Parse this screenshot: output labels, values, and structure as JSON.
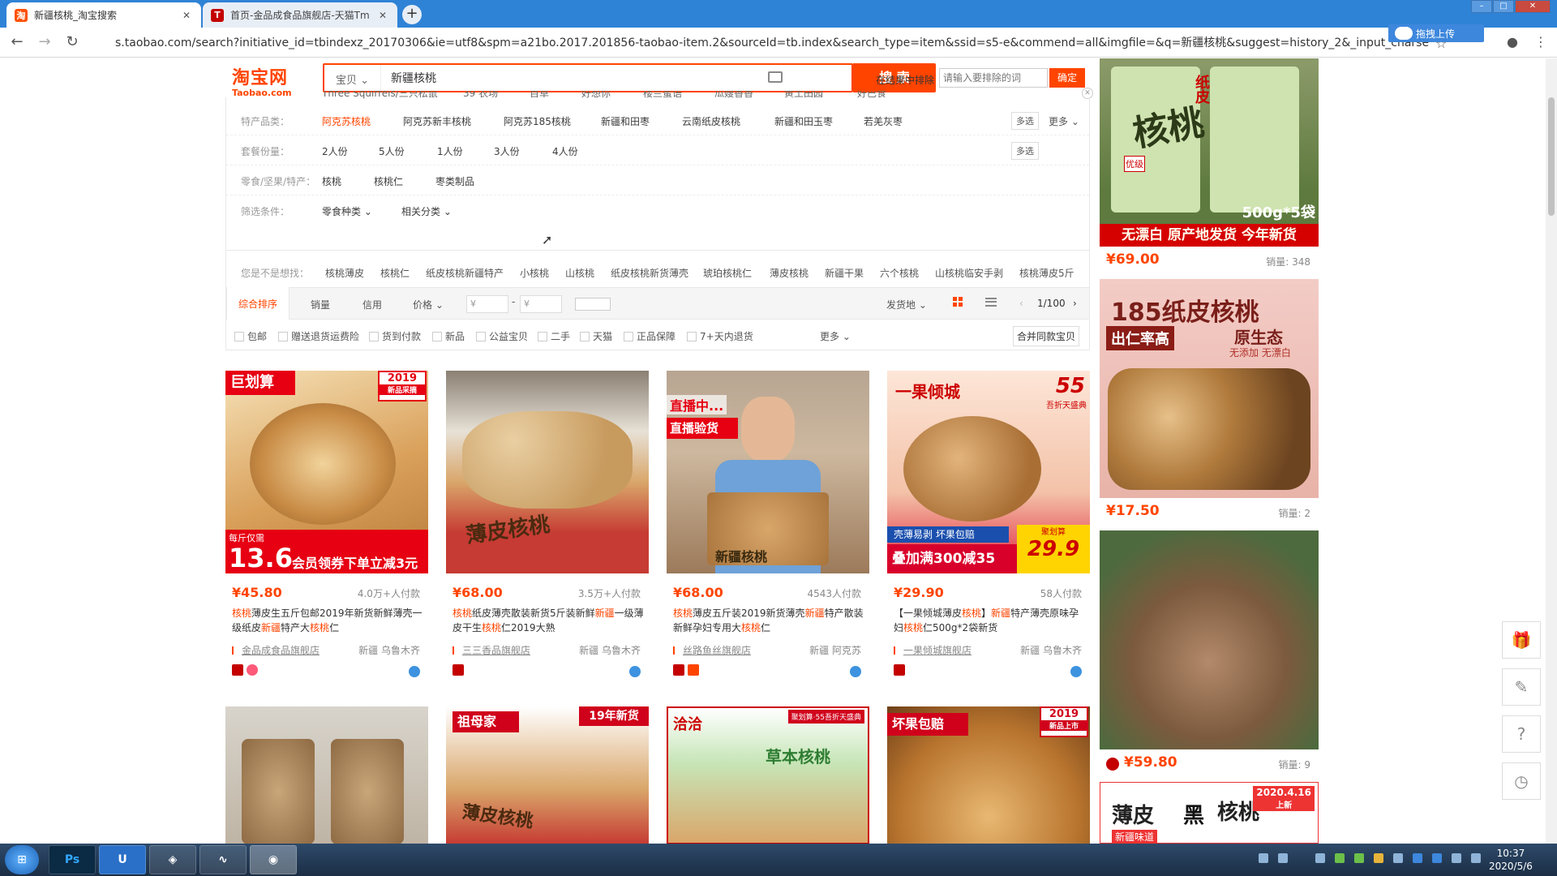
{
  "browser": {
    "tabs": [
      {
        "title": "新疆核桃_淘宝搜索",
        "icon": "淘"
      },
      {
        "title": "首页-金品成食品旗舰店-天猫Tm",
        "icon": "T"
      }
    ],
    "url": "s.taobao.com/search?initiative_id=tbindexz_20170306&ie=utf8&spm=a21bo.2017.201856-taobao-item.2&sourceId=tb.index&search_type=item&ssid=s5-e&commend=all&imgfile=&q=新疆核桃&suggest=history_2&_input_charset=utf-8",
    "upload_label": "拖拽上传",
    "new_tab_label": "+"
  },
  "header": {
    "logo_cn": "淘宝网",
    "logo_en": "Taobao.com",
    "search_category": "宝贝",
    "search_value": "新疆核桃",
    "search_button": "搜 索",
    "exclude_label": "在结果中排除",
    "exclude_placeholder": "请输入要排除的词",
    "exclude_button": "确定"
  },
  "filters": {
    "partial_row": [
      "Three Squirrels/三只松鼠",
      "39 农场",
      "百草",
      "好想你",
      "楼兰蜜语",
      "瓜嫂香香",
      "黄土田园",
      "好巴食"
    ],
    "rows": [
      {
        "label": "特产品类：",
        "items": [
          "阿克苏核桃",
          "阿克苏新丰核桃",
          "阿克苏185核桃",
          "新疆和田枣",
          "云南纸皮核桃",
          "新疆和田玉枣",
          "若羌灰枣"
        ],
        "multi": "多选",
        "more": "更多"
      },
      {
        "label": "套餐份量：",
        "items": [
          "2人份",
          "5人份",
          "1人份",
          "3人份",
          "4人份"
        ],
        "multi": "多选"
      },
      {
        "label": "零食/坚果/特产：",
        "items": [
          "核桃",
          "核桃仁",
          "枣类制品"
        ]
      },
      {
        "label": "筛选条件：",
        "items": [
          "零食种类",
          "相关分类"
        ]
      }
    ],
    "guess_label": "您是不是想找：",
    "guess_items": [
      "核桃薄皮",
      "核桃仁",
      "纸皮核桃新疆特产",
      "小核桃",
      "山核桃",
      "纸皮核桃新货薄壳",
      "琥珀核桃仁",
      "薄皮核桃",
      "新疆干果",
      "六个核桃",
      "山核桃临安手剥",
      "核桃薄皮5斤"
    ]
  },
  "sortbar": {
    "items": [
      "综合排序",
      "销量",
      "信用",
      "价格"
    ],
    "price_from": "¥",
    "price_to": "¥",
    "location": "发货地",
    "page": "1/100"
  },
  "checks": [
    "包邮",
    "赠送退货运费险",
    "货到付款",
    "新品",
    "公益宝贝",
    "二手",
    "天猫",
    "正品保障",
    "7+天内退货"
  ],
  "checks_more": "更多",
  "merge_button": "合并同款宝贝",
  "products": [
    {
      "price": "¥45.80",
      "sales": "4.0万+人付款",
      "title_pre": "",
      "title": [
        [
          "核桃",
          1
        ],
        [
          "薄皮生五斤包邮2019年新货新鲜薄壳一级纸皮",
          0
        ],
        [
          "新疆",
          1
        ],
        [
          "特产大",
          0
        ],
        [
          "核桃",
          1
        ],
        [
          "仁",
          0
        ]
      ],
      "shop": "金品成食品旗舰店",
      "loc": "新疆 乌鲁木齐",
      "img_text": [
        "巨划算",
        "2019",
        "新品采摘",
        "每斤仅需",
        "13.6",
        "会员领券下单立减3元"
      ]
    },
    {
      "price": "¥68.00",
      "sales": "3.5万+人付款",
      "title": [
        [
          "核桃",
          1
        ],
        [
          "纸皮薄壳散装新货5斤装新鲜",
          0
        ],
        [
          "新疆",
          1
        ],
        [
          "一级薄皮干生",
          0
        ],
        [
          "核桃",
          1
        ],
        [
          "仁2019大熟",
          0
        ]
      ],
      "shop": "三三香品旗舰店",
      "loc": "新疆 乌鲁木齐",
      "img_text": [
        "薄皮核桃"
      ]
    },
    {
      "price": "¥68.00",
      "sales": "4543人付款",
      "title": [
        [
          "核桃",
          1
        ],
        [
          "薄皮五斤装2019新货薄壳",
          0
        ],
        [
          "新疆",
          1
        ],
        [
          "特产散装新鲜孕妇专用大",
          0
        ],
        [
          "核桃",
          1
        ],
        [
          "仁",
          0
        ]
      ],
      "shop": "丝路鱼丝旗舰店",
      "loc": "新疆 阿克苏",
      "img_text": [
        "直播中...",
        "直播验货",
        "新疆核桃"
      ]
    },
    {
      "price": "¥29.90",
      "sales": "58人付款",
      "title": [
        [
          "【一果倾城薄皮",
          0
        ],
        [
          "核桃",
          1
        ],
        [
          "】",
          0
        ],
        [
          "新疆",
          1
        ],
        [
          "特产薄壳原味孕妇",
          0
        ],
        [
          "核桃",
          1
        ],
        [
          "仁500g*2袋新货",
          0
        ]
      ],
      "shop": "一果倾城旗舰店",
      "loc": "新疆 乌鲁木齐",
      "img_text": [
        "一果倾城",
        "55",
        "吾折天盛典",
        "壳薄易剥 坏果包赔",
        "叠加满300减35",
        "聚划算",
        "29.9"
      ]
    }
  ],
  "products_row2": [
    {
      "img_text": []
    },
    {
      "img_text": [
        "祖母家",
        "19年新货",
        "薄皮核桃"
      ]
    },
    {
      "img_text": [
        "洽洽",
        "聚划算·55吾折天盛典",
        "草本核桃"
      ]
    },
    {
      "img_text": [
        "坏果包赔",
        "2019",
        "新品上市"
      ]
    }
  ],
  "ads": [
    {
      "price": "¥69.00",
      "sales": "销量: 348",
      "img_text": [
        "纸皮",
        "核桃",
        "优级",
        "500g*5袋",
        "无漂白 原产地发货 今年新货"
      ]
    },
    {
      "price": "¥17.50",
      "sales": "销量: 2",
      "img_text": [
        "185纸皮核桃",
        "出仁率高",
        "原生态",
        "无添加 无漂白"
      ]
    },
    {
      "price": "¥59.80",
      "sales": "销量: 9",
      "img_text": []
    },
    {
      "img_text": [
        "薄皮",
        "黑",
        "核桃",
        "2020.4.16",
        "上新",
        "新疆味道"
      ]
    }
  ],
  "taskbar": {
    "time": "10:37",
    "date": "2020/5/6",
    "apps": [
      "Ps",
      "U"
    ]
  },
  "colors": {
    "accent": "#ff4400",
    "tabbar": "#2f83d6"
  }
}
